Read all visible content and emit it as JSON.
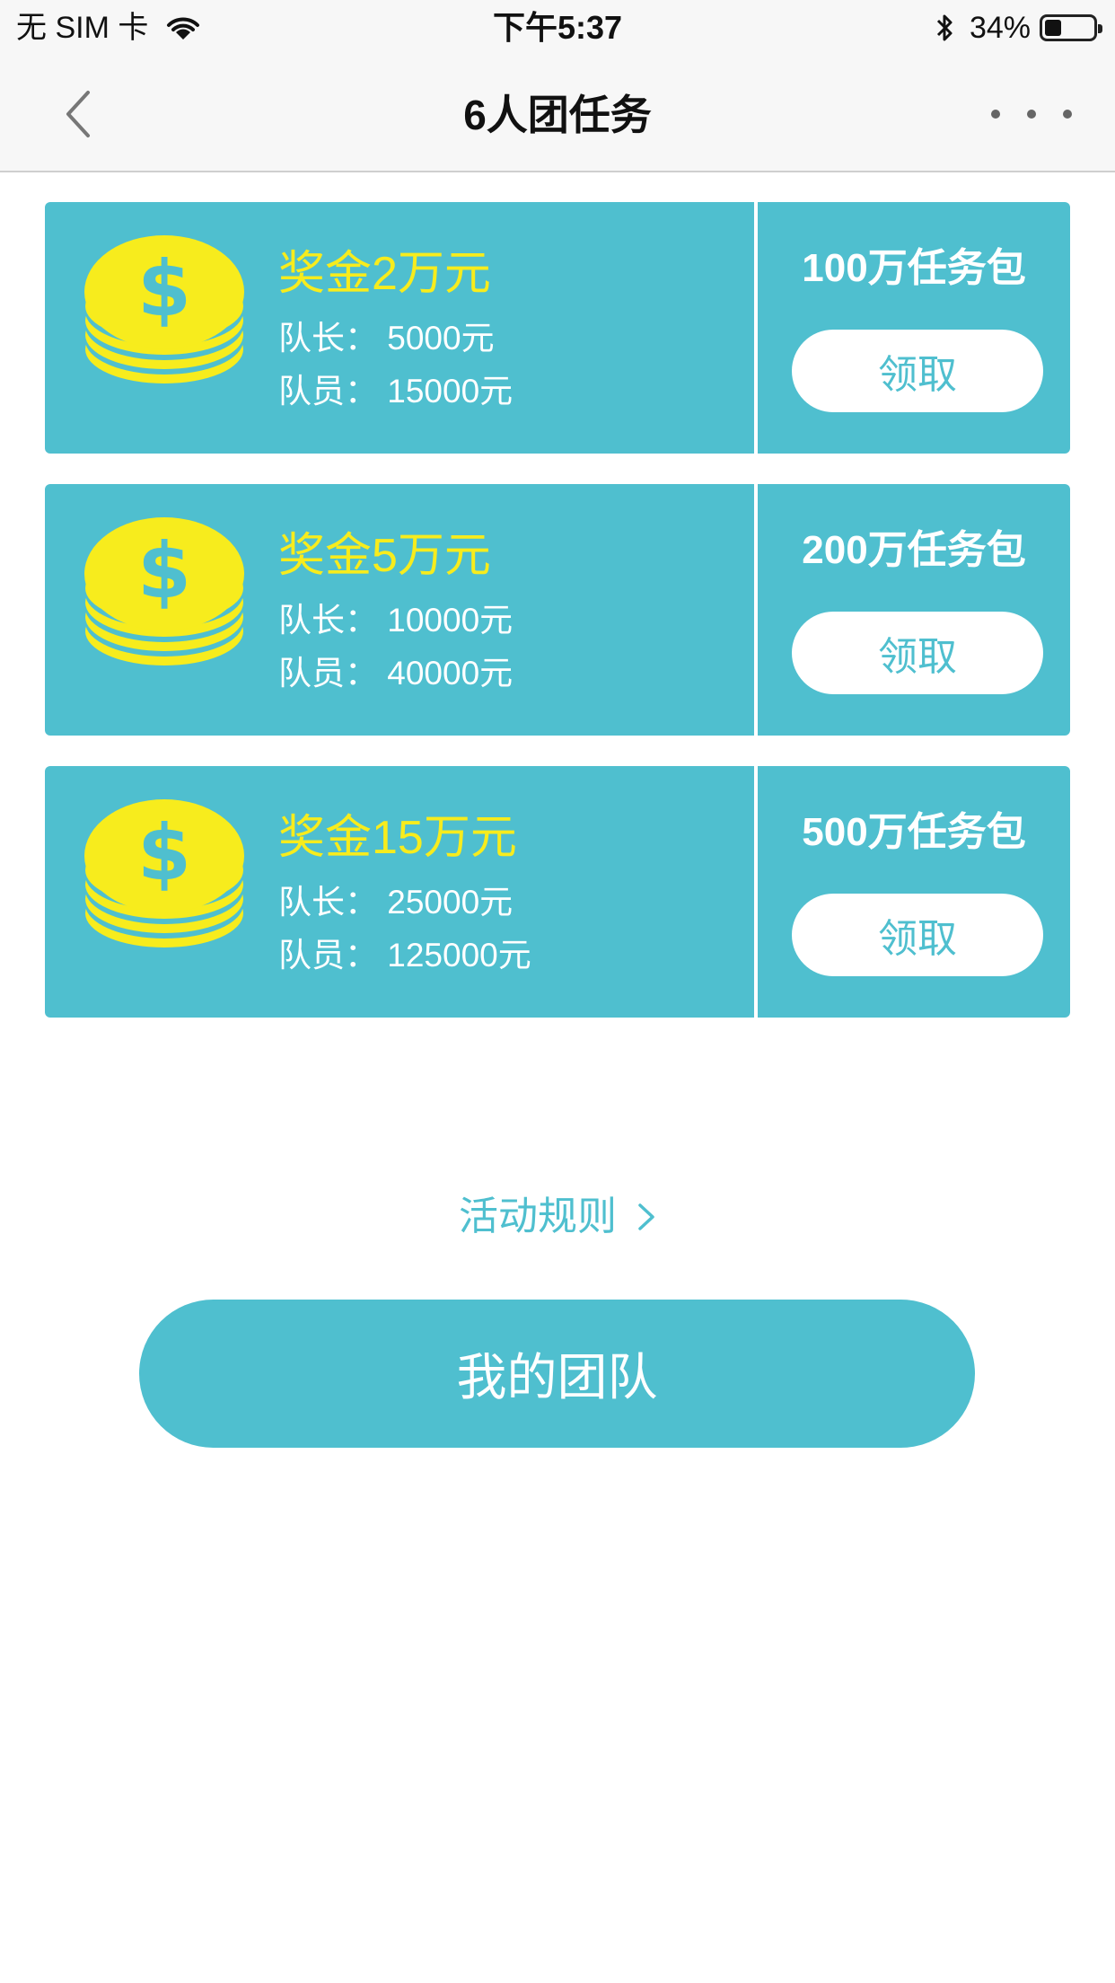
{
  "status_bar": {
    "carrier": "无 SIM 卡",
    "time": "下午5:37",
    "battery": "34%",
    "battery_level": 0.34
  },
  "nav": {
    "title": "6人团任务",
    "back_icon": "chevron-left-icon",
    "more_icon": "more-dots-icon"
  },
  "cards": [
    {
      "reward": "奖金2万元",
      "leader": "队长：  5000元",
      "member": "队员：  15000元",
      "package": "100万任务包",
      "button": "领取"
    },
    {
      "reward": "奖金5万元",
      "leader": "队长：  10000元",
      "member": "队员：  40000元",
      "package": "200万任务包",
      "button": "领取"
    },
    {
      "reward": "奖金15万元",
      "leader": "队长：  25000元",
      "member": "队员：  125000元",
      "package": "500万任务包",
      "button": "领取"
    }
  ],
  "rules": {
    "label": "活动规则"
  },
  "team_button": {
    "label": "我的团队"
  },
  "colors": {
    "accent": "#4fbfcf",
    "coin": "#f7ec1d",
    "reward_text": "#f7ec1d"
  }
}
